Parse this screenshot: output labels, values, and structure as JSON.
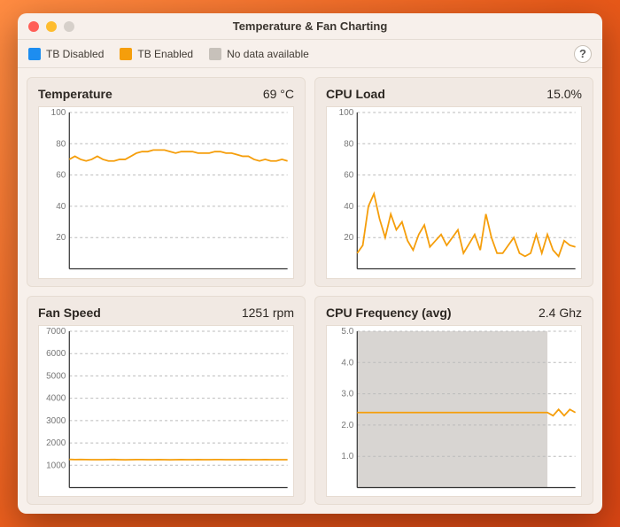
{
  "window": {
    "title": "Temperature & Fan Charting"
  },
  "legend": {
    "items": [
      {
        "label": "TB Disabled",
        "color": "#1d8df0"
      },
      {
        "label": "TB Enabled",
        "color": "#f59e0b"
      },
      {
        "label": "No data available",
        "color": "#c7c1ba"
      }
    ],
    "help_tooltip": "?"
  },
  "colors": {
    "series_enabled": "#f59e0b",
    "series_disabled": "#1d8df0",
    "nodata": "#b8b3ad"
  },
  "panels": [
    {
      "key": "temperature",
      "title": "Temperature",
      "value": "69 °C"
    },
    {
      "key": "cpu_load",
      "title": "CPU Load",
      "value": "15.0%"
    },
    {
      "key": "fan_speed",
      "title": "Fan Speed",
      "value": "1251 rpm"
    },
    {
      "key": "cpu_freq",
      "title": "CPU Frequency (avg)",
      "value": "2.4 Ghz"
    }
  ],
  "chart_data": [
    {
      "panel": "temperature",
      "type": "line",
      "title": "Temperature",
      "ylabel": "",
      "ylim": [
        0,
        100
      ],
      "yticks": [
        20,
        40,
        60,
        80,
        100
      ],
      "x": [
        0,
        1,
        2,
        3,
        4,
        5,
        6,
        7,
        8,
        9,
        10,
        11,
        12,
        13,
        14,
        15,
        16,
        17,
        18,
        19,
        20,
        21,
        22,
        23,
        24,
        25,
        26,
        27,
        28,
        29,
        30,
        31,
        32,
        33,
        34,
        35,
        36,
        37,
        38,
        39
      ],
      "series": [
        {
          "name": "TB Enabled",
          "color": "#f59e0b",
          "values": [
            70,
            72,
            70,
            69,
            70,
            72,
            70,
            69,
            69,
            70,
            70,
            72,
            74,
            75,
            75,
            76,
            76,
            76,
            75,
            74,
            75,
            75,
            75,
            74,
            74,
            74,
            75,
            75,
            74,
            74,
            73,
            72,
            72,
            70,
            69,
            70,
            69,
            69,
            70,
            69
          ]
        }
      ],
      "nodata_ranges": []
    },
    {
      "panel": "cpu_load",
      "type": "line",
      "title": "CPU Load",
      "ylabel": "",
      "ylim": [
        0,
        100
      ],
      "yticks": [
        20,
        40,
        60,
        80,
        100
      ],
      "x": [
        0,
        1,
        2,
        3,
        4,
        5,
        6,
        7,
        8,
        9,
        10,
        11,
        12,
        13,
        14,
        15,
        16,
        17,
        18,
        19,
        20,
        21,
        22,
        23,
        24,
        25,
        26,
        27,
        28,
        29,
        30,
        31,
        32,
        33,
        34,
        35,
        36,
        37,
        38,
        39
      ],
      "series": [
        {
          "name": "TB Enabled",
          "color": "#f59e0b",
          "values": [
            10,
            15,
            40,
            48,
            32,
            20,
            35,
            25,
            30,
            18,
            12,
            22,
            28,
            14,
            18,
            22,
            15,
            20,
            25,
            10,
            16,
            22,
            12,
            35,
            20,
            10,
            10,
            15,
            20,
            10,
            8,
            10,
            22,
            10,
            22,
            12,
            8,
            18,
            15,
            14
          ]
        }
      ],
      "nodata_ranges": []
    },
    {
      "panel": "fan_speed",
      "type": "line",
      "title": "Fan Speed",
      "ylabel": "",
      "ylim": [
        0,
        7000
      ],
      "yticks": [
        1000,
        2000,
        3000,
        4000,
        5000,
        6000,
        7000
      ],
      "x": [
        0,
        1,
        2,
        3,
        4,
        5,
        6,
        7,
        8,
        9,
        10,
        11,
        12,
        13,
        14,
        15,
        16,
        17,
        18,
        19,
        20,
        21,
        22,
        23,
        24,
        25,
        26,
        27,
        28,
        29,
        30,
        31,
        32,
        33,
        34,
        35,
        36,
        37,
        38,
        39
      ],
      "series": [
        {
          "name": "TB Enabled",
          "color": "#f59e0b",
          "values": [
            1260,
            1255,
            1258,
            1252,
            1250,
            1251,
            1249,
            1253,
            1257,
            1250,
            1246,
            1250,
            1255,
            1252,
            1249,
            1251,
            1254,
            1250,
            1247,
            1251,
            1253,
            1249,
            1250,
            1252,
            1248,
            1251,
            1254,
            1252,
            1249,
            1250,
            1251,
            1253,
            1250,
            1248,
            1251,
            1252,
            1249,
            1250,
            1251,
            1250
          ]
        }
      ],
      "nodata_ranges": []
    },
    {
      "panel": "cpu_freq",
      "type": "line",
      "title": "CPU Frequency (avg)",
      "ylabel": "",
      "ylim": [
        0,
        5.0
      ],
      "yticks": [
        1.0,
        2.0,
        3.0,
        4.0,
        5.0
      ],
      "x": [
        0,
        1,
        2,
        3,
        4,
        5,
        6,
        7,
        8,
        9,
        10,
        11,
        12,
        13,
        14,
        15,
        16,
        17,
        18,
        19,
        20,
        21,
        22,
        23,
        24,
        25,
        26,
        27,
        28,
        29,
        30,
        31,
        32,
        33,
        34,
        35,
        36,
        37,
        38,
        39
      ],
      "series": [
        {
          "name": "TB Enabled",
          "color": "#f59e0b",
          "values": [
            2.4,
            2.4,
            2.4,
            2.4,
            2.4,
            2.4,
            2.4,
            2.4,
            2.4,
            2.4,
            2.4,
            2.4,
            2.4,
            2.4,
            2.4,
            2.4,
            2.4,
            2.4,
            2.4,
            2.4,
            2.4,
            2.4,
            2.4,
            2.4,
            2.4,
            2.4,
            2.4,
            2.4,
            2.4,
            2.4,
            2.4,
            2.4,
            2.4,
            2.4,
            2.4,
            2.3,
            2.5,
            2.3,
            2.5,
            2.4
          ]
        }
      ],
      "nodata_ranges": [
        {
          "x_start": 0,
          "x_end": 34
        }
      ]
    }
  ]
}
